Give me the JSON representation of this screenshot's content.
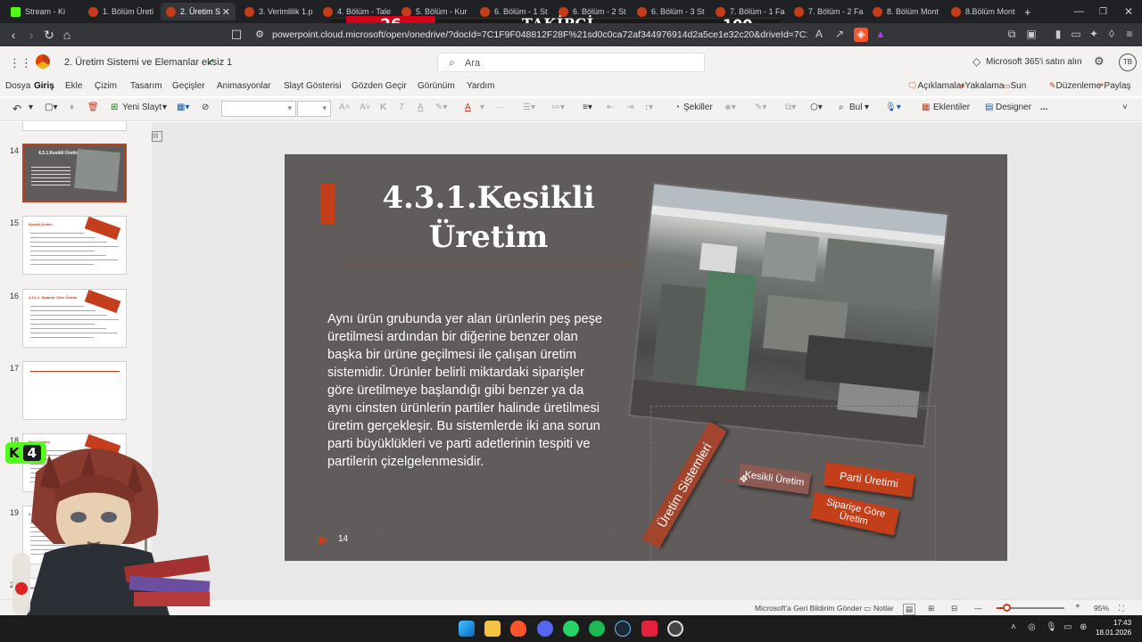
{
  "browser": {
    "tabs": [
      {
        "label": "Stream - Ki",
        "active": false
      },
      {
        "label": "1. Bölüm Üreti",
        "active": false
      },
      {
        "label": "2. Üretim S",
        "active": true
      },
      {
        "label": "3. Verimlilik 1.p",
        "active": false
      },
      {
        "label": "4. Bölüm - Tale",
        "active": false
      },
      {
        "label": "5. Bölüm - Kur",
        "active": false
      },
      {
        "label": "6. Bölüm - 1 St",
        "active": false
      },
      {
        "label": "6. Bölüm - 2 St",
        "active": false
      },
      {
        "label": "6. Bölüm - 3 St",
        "active": false
      },
      {
        "label": "7. Bölüm - 1 Fa",
        "active": false
      },
      {
        "label": "7. Bölüm - 2 Fa",
        "active": false
      },
      {
        "label": "8. Bölüm Mont",
        "active": false
      },
      {
        "label": "8.Bölüm Mont",
        "active": false
      }
    ],
    "new_tab": "+",
    "url": "powerpoint.cloud.microsoft/open/onedrive/?docId=7C1F9F048812F28F%21sd0c0ca72af344976914d2a5ce1e32c20&driveId=7C1F9F048812F28F"
  },
  "stream_overlay": {
    "left_value": "26",
    "label": "TAKİPÇİ",
    "right_value": "100",
    "badge_letter": "K",
    "badge_value": "4"
  },
  "app": {
    "filename": "2. Üretim Sistemi ve Elemanlar eksiz 1",
    "search_placeholder": "Ara",
    "buy_label": "Microsoft 365'i satın alın",
    "user_initials": "TB"
  },
  "menu": {
    "tabs": [
      "Dosya",
      "Giriş",
      "Ekle",
      "Çizim",
      "Tasarım",
      "Geçişler",
      "Animasyonlar",
      "Slayt Gösterisi",
      "Gözden Geçir",
      "Görünüm",
      "Yardım"
    ],
    "active": "Giriş",
    "right": [
      "Açıklamalar",
      "Yakalama",
      "Sun",
      "Düzenleme",
      "Paylaş"
    ]
  },
  "ribbon": {
    "new_slide": "Yeni Slayt",
    "shapes": "Şekiller",
    "find": "Bul",
    "addins": "Eklentiler",
    "designer": "Designer",
    "more": "..."
  },
  "thumbnails": [
    {
      "num": "14",
      "title": "4.3.1.Kesikli Üretim",
      "selected": true
    },
    {
      "num": "15",
      "title": "Kesikli Üretim",
      "selected": false
    },
    {
      "num": "16",
      "title": "4.3.1.1. Siparişe Göre Üretim",
      "selected": false
    },
    {
      "num": "17",
      "title": "",
      "selected": false
    },
    {
      "num": "18",
      "title": "Parti Üretimi",
      "selected": false
    },
    {
      "num": "19",
      "title": "4.3.1.",
      "selected": false
    },
    {
      "num": "20",
      "title": "",
      "selected": false
    }
  ],
  "slide": {
    "title": "4.3.1.Kesikli Üretim",
    "body": "Aynı ürün grubunda yer alan ürünlerin peş peşe üretilmesi ardından bir diğerine benzer olan başka bir ürüne geçilmesi ile çalışan üretim sistemidir. Ürünler belirli miktardaki siparişler  göre üretilmeye başlandığı gibi benzer ya da aynı cinsten ürünlerin partiler halinde üretilmesi üretim gerçekleşir. Bu sistemlerde iki ana sorun parti büyüklükleri ve parti adetlerinin tespiti ve partilerin çizelgelenmesidir.",
    "number": "14",
    "diagram": {
      "root": "Üretim Sistemleri",
      "node": "Kesikli Üretim",
      "children": [
        "Parti Üretimi",
        "Siparişe Göre Üretim"
      ]
    },
    "accent_color": "#c33f1a",
    "background_color": "#605c5b"
  },
  "status": {
    "feedback": "Microsoft'a Geri Bildirim Gönder",
    "notes": "Notlar",
    "zoom_minus": "—",
    "zoom_plus": "+",
    "zoom": "95%",
    "zoom_fraction": 0.15
  },
  "taskbar": {
    "time": "17:43",
    "date": "18.01.2026"
  }
}
